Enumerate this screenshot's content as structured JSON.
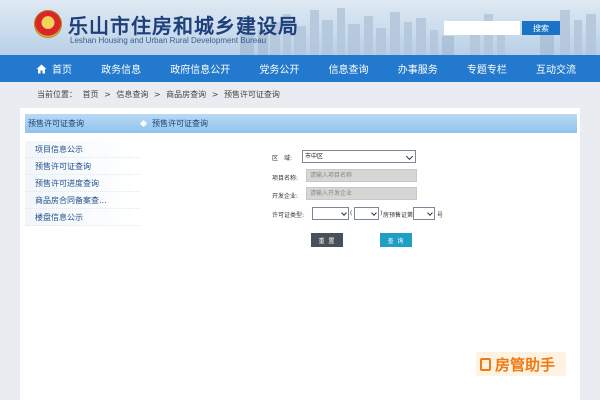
{
  "header": {
    "title": "乐山市住房和城乡建设局",
    "subtitle": "Leshan Housing and Urban Rural Development Bureau",
    "search_placeholder": "",
    "search_label": "搜索"
  },
  "nav": {
    "items": [
      "首页",
      "政务信息",
      "政府信息公开",
      "党务公开",
      "信息查询",
      "办事服务",
      "专题专栏",
      "互动交流"
    ]
  },
  "breadcrumb": {
    "prefix": "当前位置：",
    "items": [
      "首页",
      ">",
      "信息查询",
      ">",
      "商品房查询",
      ">",
      "预售许可证查询"
    ]
  },
  "sidebar": {
    "title": "预售许可证查询",
    "items": [
      "项目信息公示",
      "预售许可证查询",
      "预售许可进度查询",
      "商品房合同备案查...",
      "楼盘信息公示"
    ]
  },
  "content": {
    "title": "预售许可证查询",
    "region_label": "区　域:",
    "region_value": "市中区",
    "project_label": "项目名称:",
    "project_placeholder": "请输入项目名称",
    "developer_label": "开发企业:",
    "developer_placeholder": "请输入开发企业",
    "license_label": "许可证类型:",
    "paren_open": "(",
    "paren_close": ")",
    "license_mid": "房预售证第",
    "license_end": "号",
    "reset_label": "重 置",
    "query_label": "查 询"
  },
  "watermark": {
    "text": "房管助手"
  },
  "colors": {
    "nav": "#2379cd",
    "title": "#1e3f7a",
    "query": "#1f9fc6",
    "reset": "#4a5058",
    "watermark": "#ee7a16"
  }
}
